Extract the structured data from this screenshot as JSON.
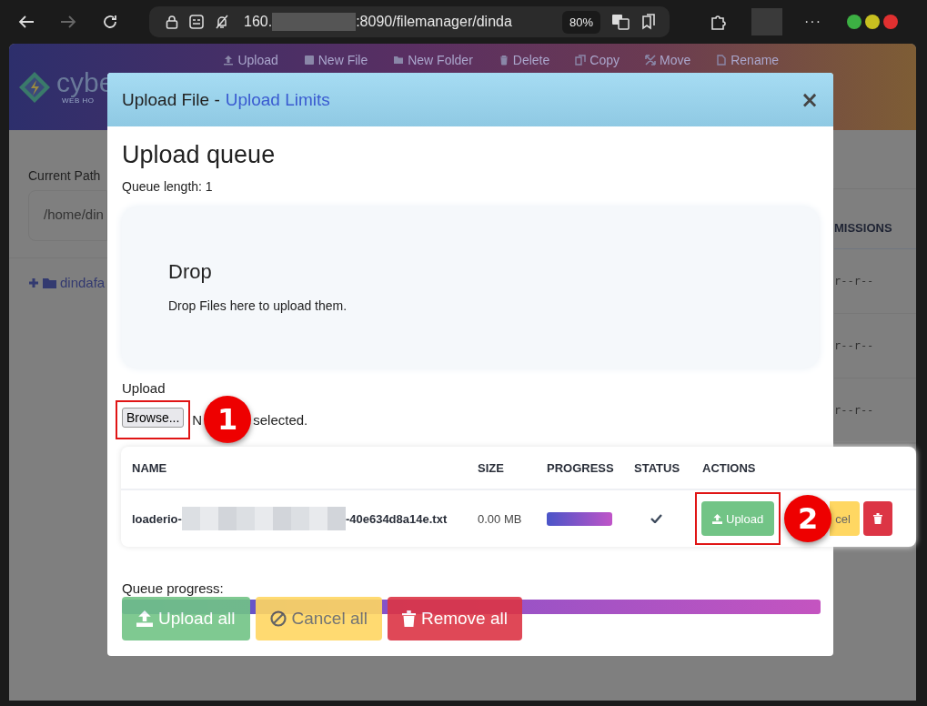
{
  "browser": {
    "url_start": "160.",
    "url_end": ":8090/filemanager/dinda",
    "zoom": "80%",
    "more": "···"
  },
  "page": {
    "logo_text": "cybe",
    "logo_subtitle": "WEB HO",
    "toolbar": [
      {
        "kind": "upload",
        "label": "Upload"
      },
      {
        "kind": "file",
        "label": "New File"
      },
      {
        "kind": "folder",
        "label": "New Folder"
      },
      {
        "kind": "delete",
        "label": "Delete"
      },
      {
        "kind": "copy",
        "label": "Copy"
      },
      {
        "kind": "move",
        "label": "Move"
      },
      {
        "kind": "rename",
        "label": "Rename"
      }
    ],
    "current_path_label": "Current Path",
    "current_path": "/home/din",
    "folder": "dindafa",
    "column_heading": "MISSIONS",
    "permissions": [
      "r--r--",
      "r--r--",
      "r--r--"
    ]
  },
  "dialog": {
    "title": "Upload File -",
    "title_link": "Upload Limits",
    "close": "×",
    "heading": "Upload queue",
    "queue_length": "Queue length: 1",
    "drop": {
      "title": "Drop",
      "text": "Drop Files here to upload them."
    },
    "upload_label": "Upload",
    "browse": "Browse...",
    "file_status_start": "N",
    "file_status_end": "selected.",
    "table": {
      "columns": [
        "NAME",
        "SIZE",
        "PROGRESS",
        "STATUS",
        "ACTIONS"
      ],
      "rows": [
        {
          "name_start": "loaderio-",
          "name_end": "-40e634d8a14e.txt",
          "size": "0.00 MB",
          "level": 1,
          "done": true,
          "actions": [
            {
              "kind": "upload",
              "label": "Upload"
            },
            {
              "kind": "cancel",
              "label": "cel"
            },
            {
              "kind": "remove"
            }
          ]
        }
      ]
    },
    "queue_progress": {
      "label": "Queue progress:",
      "level": 1
    },
    "buttons": [
      {
        "kind": "upload",
        "label": "Upload all"
      },
      {
        "kind": "cancel",
        "label": "Cancel all"
      },
      {
        "kind": "remove",
        "label": "Remove all"
      }
    ]
  },
  "annotations": [
    "1",
    "2"
  ]
}
